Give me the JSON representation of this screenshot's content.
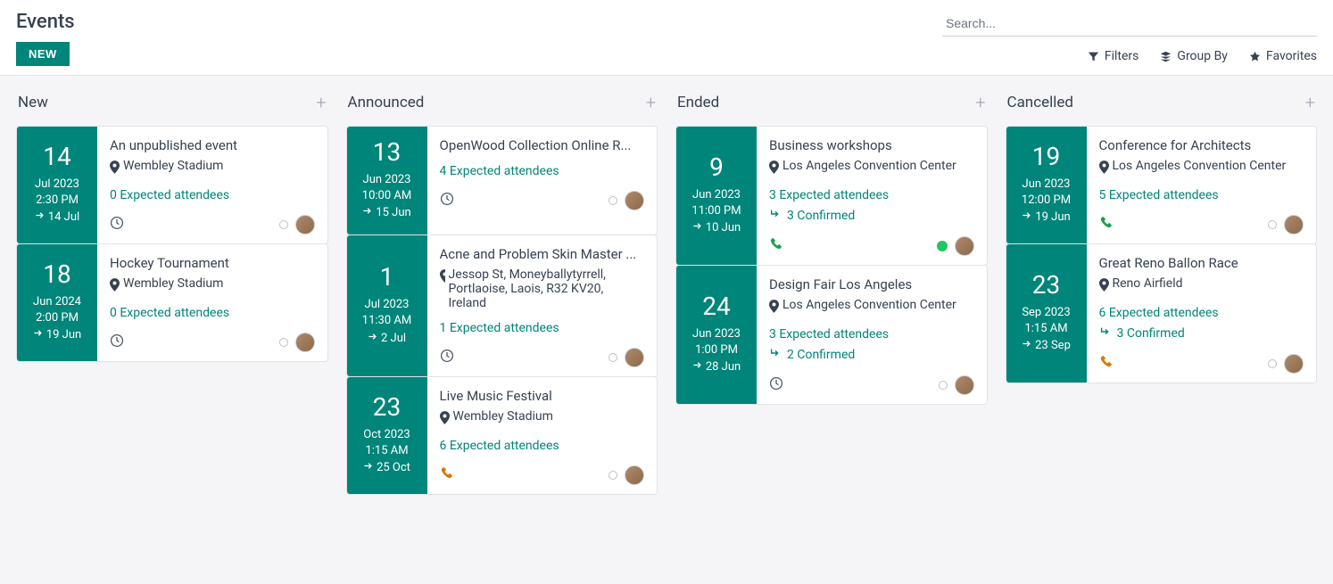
{
  "header": {
    "title": "Events",
    "new_button": "NEW",
    "search_placeholder": "Search...",
    "filters": "Filters",
    "groupby": "Group By",
    "favorites": "Favorites"
  },
  "columns": [
    {
      "title": "New",
      "cards": [
        {
          "day": "14",
          "month": "Jul 2023",
          "time": "2:30 PM",
          "end": "14 Jul",
          "title": "An unpublished event",
          "location": "Wembley Stadium",
          "attendees": "0 Expected attendees",
          "confirmed": "",
          "footer_icon": "clock",
          "status_dot": "gray"
        },
        {
          "day": "18",
          "month": "Jun 2024",
          "time": "2:00 PM",
          "end": "19 Jun",
          "title": "Hockey Tournament",
          "location": "Wembley Stadium",
          "attendees": "0 Expected attendees",
          "confirmed": "",
          "footer_icon": "clock",
          "status_dot": "gray"
        }
      ]
    },
    {
      "title": "Announced",
      "cards": [
        {
          "day": "13",
          "month": "Jun 2023",
          "time": "10:00 AM",
          "end": "15 Jun",
          "title": "OpenWood Collection Online R...",
          "location": "",
          "attendees": "4 Expected attendees",
          "confirmed": "",
          "footer_icon": "clock",
          "status_dot": "gray"
        },
        {
          "day": "1",
          "month": "Jul 2023",
          "time": "11:30 AM",
          "end": "2 Jul",
          "title": "Acne and Problem Skin Master ...",
          "location": "Jessop St, Moneyballytyrrell, Portlaoise, Laois, R32 KV20, Ireland",
          "attendees": "1 Expected attendees",
          "confirmed": "",
          "footer_icon": "clock",
          "status_dot": "gray"
        },
        {
          "day": "23",
          "month": "Oct 2023",
          "time": "1:15 AM",
          "end": "25 Oct",
          "title": "Live Music Festival",
          "location": "Wembley Stadium",
          "attendees": "6 Expected attendees",
          "confirmed": "",
          "footer_icon": "phone-orange",
          "status_dot": "gray"
        }
      ]
    },
    {
      "title": "Ended",
      "cards": [
        {
          "day": "9",
          "month": "Jun 2023",
          "time": "11:00 PM",
          "end": "10 Jun",
          "title": "Business workshops",
          "location": "Los Angeles Convention Center",
          "attendees": "3 Expected attendees",
          "confirmed": "3 Confirmed",
          "footer_icon": "phone-green",
          "status_dot": "green"
        },
        {
          "day": "24",
          "month": "Jun 2023",
          "time": "1:00 PM",
          "end": "28 Jun",
          "title": "Design Fair Los Angeles",
          "location": "Los Angeles Convention Center",
          "attendees": "3 Expected attendees",
          "confirmed": "2 Confirmed",
          "footer_icon": "clock",
          "status_dot": "gray"
        }
      ]
    },
    {
      "title": "Cancelled",
      "cards": [
        {
          "day": "19",
          "month": "Jun 2023",
          "time": "12:00 PM",
          "end": "19 Jun",
          "title": "Conference for Architects",
          "location": "Los Angeles Convention Center",
          "attendees": "5 Expected attendees",
          "confirmed": "",
          "footer_icon": "phone-green",
          "status_dot": "gray"
        },
        {
          "day": "23",
          "month": "Sep 2023",
          "time": "1:15 AM",
          "end": "23 Sep",
          "title": "Great Reno Ballon Race",
          "location": "Reno Airfield",
          "attendees": "6 Expected attendees",
          "confirmed": "3 Confirmed",
          "footer_icon": "phone-orange",
          "status_dot": "gray"
        }
      ]
    }
  ]
}
